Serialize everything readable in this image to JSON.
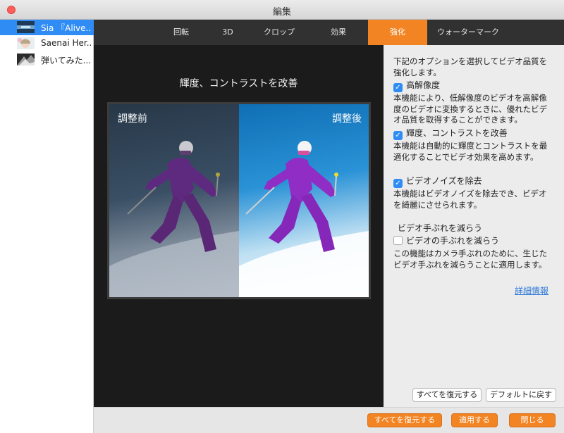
{
  "window": {
    "title": "編集"
  },
  "files": [
    {
      "name": "Sia 『Alive...",
      "thumb": "video-thumb-1"
    },
    {
      "name": "Saenai Her...",
      "thumb": "video-thumb-2"
    },
    {
      "name": "弾いてみた...",
      "thumb": "video-thumb-3"
    }
  ],
  "tabs": [
    {
      "label": "回転"
    },
    {
      "label": "3D"
    },
    {
      "label": "クロップ"
    },
    {
      "label": "効果"
    },
    {
      "label": "強化"
    },
    {
      "label": "ウォーターマーク"
    }
  ],
  "preview": {
    "title": "輝度、コントラストを改善",
    "before_label": "調整前",
    "after_label": "調整後"
  },
  "options": {
    "intro": "下記のオプションを選択してビデオ品質を強化します。",
    "upscale": {
      "label": "高解像度",
      "checked": true,
      "desc": "本機能により、低解像度のビデオを高解像度のビデオに変換するときに、優れたビデオ品質を取得することができます。"
    },
    "brightness": {
      "label": "輝度、コントラストを改善",
      "checked": true,
      "desc": "本機能は自動的に輝度とコントラストを最適化することでビデオ効果を高めます。"
    },
    "denoise": {
      "label": "ビデオノイズを除去",
      "checked": true,
      "desc": "本機能はビデオノイズを除去でき、ビデオを綺麗にさせられます。"
    },
    "stabilize_heading": "ビデオ手ぶれを減らう",
    "stabilize": {
      "label": "ビデオの手ぶれを減らう",
      "checked": false,
      "desc": "この機能はカメラ手ぶれのために、生じたビデオ手ぶれを減らうことに適用します。"
    },
    "details_link": "詳細情報"
  },
  "panel_buttons": {
    "restore_all": "すべてを復元する",
    "reset_default": "デフォルトに戻す"
  },
  "footer_buttons": {
    "restore_all": "すべてを復元する",
    "apply": "適用する",
    "close": "閉じる"
  },
  "colors": {
    "accent": "#f28423",
    "selection": "#2f8cf5",
    "link": "#2f7ad8"
  }
}
